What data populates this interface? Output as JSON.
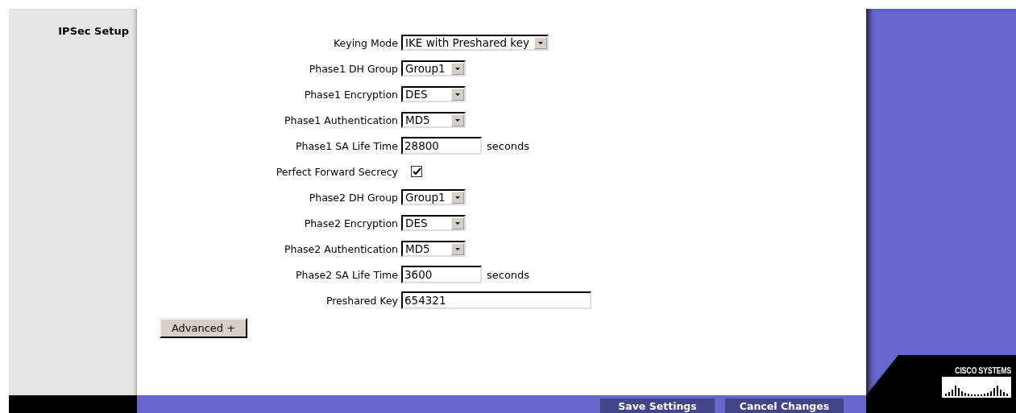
{
  "sidebar": {
    "title": "IPSec Setup"
  },
  "fields": [
    {
      "kind": "select",
      "label": "Keying Mode",
      "value": "IKE with Preshared key"
    },
    {
      "kind": "select",
      "label": "Phase1 DH Group",
      "value": "Group1"
    },
    {
      "kind": "select",
      "label": "Phase1 Encryption",
      "value": "DES"
    },
    {
      "kind": "select",
      "label": "Phase1 Authentication",
      "value": "MD5"
    },
    {
      "kind": "text",
      "label": "Phase1 SA Life Time",
      "value": "28800",
      "unit": "seconds"
    },
    {
      "kind": "checkbox",
      "label": "Perfect Forward Secrecy",
      "checked": true
    },
    {
      "kind": "select",
      "label": "Phase2 DH Group",
      "value": "Group1"
    },
    {
      "kind": "select",
      "label": "Phase2 Encryption",
      "value": "DES"
    },
    {
      "kind": "select",
      "label": "Phase2 Authentication",
      "value": "MD5"
    },
    {
      "kind": "text",
      "label": "Phase2 SA Life Time",
      "value": "3600",
      "unit": "seconds"
    },
    {
      "kind": "wide",
      "label": "Preshared Key",
      "value": "654321"
    }
  ],
  "advanced_button": "Advanced +",
  "footer_buttons": [
    "Save Settings",
    "Cancel Changes"
  ],
  "brand": {
    "name": "CISCO SYSTEMS"
  }
}
